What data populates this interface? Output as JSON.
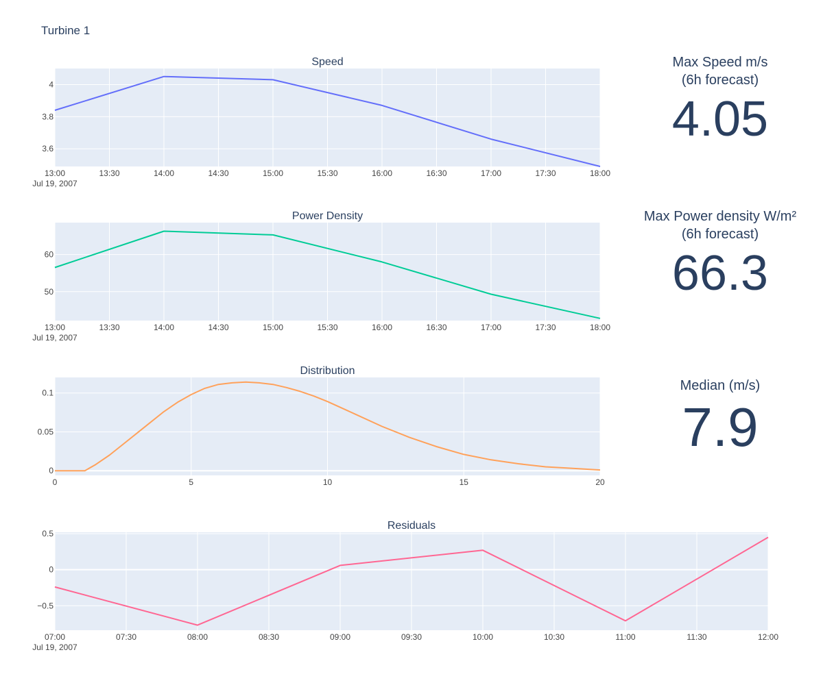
{
  "page": {
    "title": "Turbine 1"
  },
  "theme": {
    "plot_bg": "#e5ecf6",
    "grid": "#ffffff",
    "text": "#2a3f5f",
    "tick_text": "#444444"
  },
  "indicators": [
    {
      "title_line1": "Max Speed m/s",
      "title_line2": "(6h forecast)",
      "value": "4.05"
    },
    {
      "title_line1": "Max Power density W/m²",
      "title_line2": "(6h forecast)",
      "value": "66.3"
    },
    {
      "title_line1": "Median (m/s)",
      "title_line2": "",
      "value": "7.9"
    }
  ],
  "chart_data": [
    {
      "id": "speed",
      "type": "line",
      "title": "Speed",
      "color": "#636efa",
      "x_date": "Jul 19, 2007",
      "x_ticks": [
        "13:00",
        "13:30",
        "14:00",
        "14:30",
        "15:00",
        "15:30",
        "16:00",
        "16:30",
        "17:00",
        "17:30",
        "18:00"
      ],
      "x": [
        "13:00",
        "14:00",
        "15:00",
        "16:00",
        "17:00",
        "18:00"
      ],
      "y": [
        3.84,
        4.05,
        4.03,
        3.87,
        3.66,
        3.49
      ],
      "y_ticks": [
        "3.6",
        "3.8",
        "4"
      ],
      "xlim": [
        "13:00",
        "18:00"
      ],
      "ylim": [
        3.49,
        4.1
      ],
      "grid": true
    },
    {
      "id": "power",
      "type": "line",
      "title": "Power Density",
      "color": "#00cc96",
      "x_date": "Jul 19, 2007",
      "x_ticks": [
        "13:00",
        "13:30",
        "14:00",
        "14:30",
        "15:00",
        "15:30",
        "16:00",
        "16:30",
        "17:00",
        "17:30",
        "18:00"
      ],
      "x": [
        "13:00",
        "14:00",
        "15:00",
        "16:00",
        "17:00",
        "18:00"
      ],
      "y": [
        56.5,
        66.3,
        65.3,
        58.0,
        49.3,
        42.8
      ],
      "y_ticks": [
        "50",
        "60"
      ],
      "xlim": [
        "13:00",
        "18:00"
      ],
      "ylim": [
        42.2,
        68.6
      ],
      "grid": true
    },
    {
      "id": "distribution",
      "type": "line",
      "title": "Distribution",
      "color": "#ffa15a",
      "x": [
        0,
        0.5,
        1.1,
        1.5,
        2,
        2.5,
        3,
        3.5,
        4,
        4.5,
        5,
        5.5,
        6,
        6.5,
        7,
        7.5,
        8,
        8.5,
        9,
        9.5,
        10,
        11,
        12,
        13,
        14,
        15,
        16,
        17,
        18,
        19,
        20
      ],
      "y": [
        0,
        0,
        0,
        0.008,
        0.02,
        0.034,
        0.048,
        0.062,
        0.076,
        0.088,
        0.098,
        0.106,
        0.111,
        0.113,
        0.114,
        0.113,
        0.111,
        0.107,
        0.102,
        0.096,
        0.089,
        0.073,
        0.057,
        0.043,
        0.031,
        0.021,
        0.014,
        0.009,
        0.005,
        0.003,
        0.001
      ],
      "x_ticks": [
        "0",
        "5",
        "10",
        "15",
        "20"
      ],
      "y_ticks": [
        "0",
        "0.05",
        "0.1"
      ],
      "xlim": [
        0,
        20
      ],
      "ylim": [
        -0.006,
        0.12
      ],
      "grid": true
    },
    {
      "id": "residuals",
      "type": "line",
      "title": "Residuals",
      "color": "#ff6692",
      "x_date": "Jul 19, 2007",
      "x_ticks": [
        "07:00",
        "07:30",
        "08:00",
        "08:30",
        "09:00",
        "09:30",
        "10:00",
        "10:30",
        "11:00",
        "11:30",
        "12:00"
      ],
      "x": [
        "07:00",
        "08:00",
        "09:00",
        "10:00",
        "11:00",
        "12:00"
      ],
      "y": [
        -0.24,
        -0.77,
        0.06,
        0.27,
        -0.71,
        0.45
      ],
      "y_ticks": [
        "−0.5",
        "0",
        "0.5"
      ],
      "xlim": [
        "07:00",
        "12:00"
      ],
      "ylim": [
        -0.84,
        0.52
      ],
      "grid": true
    }
  ]
}
